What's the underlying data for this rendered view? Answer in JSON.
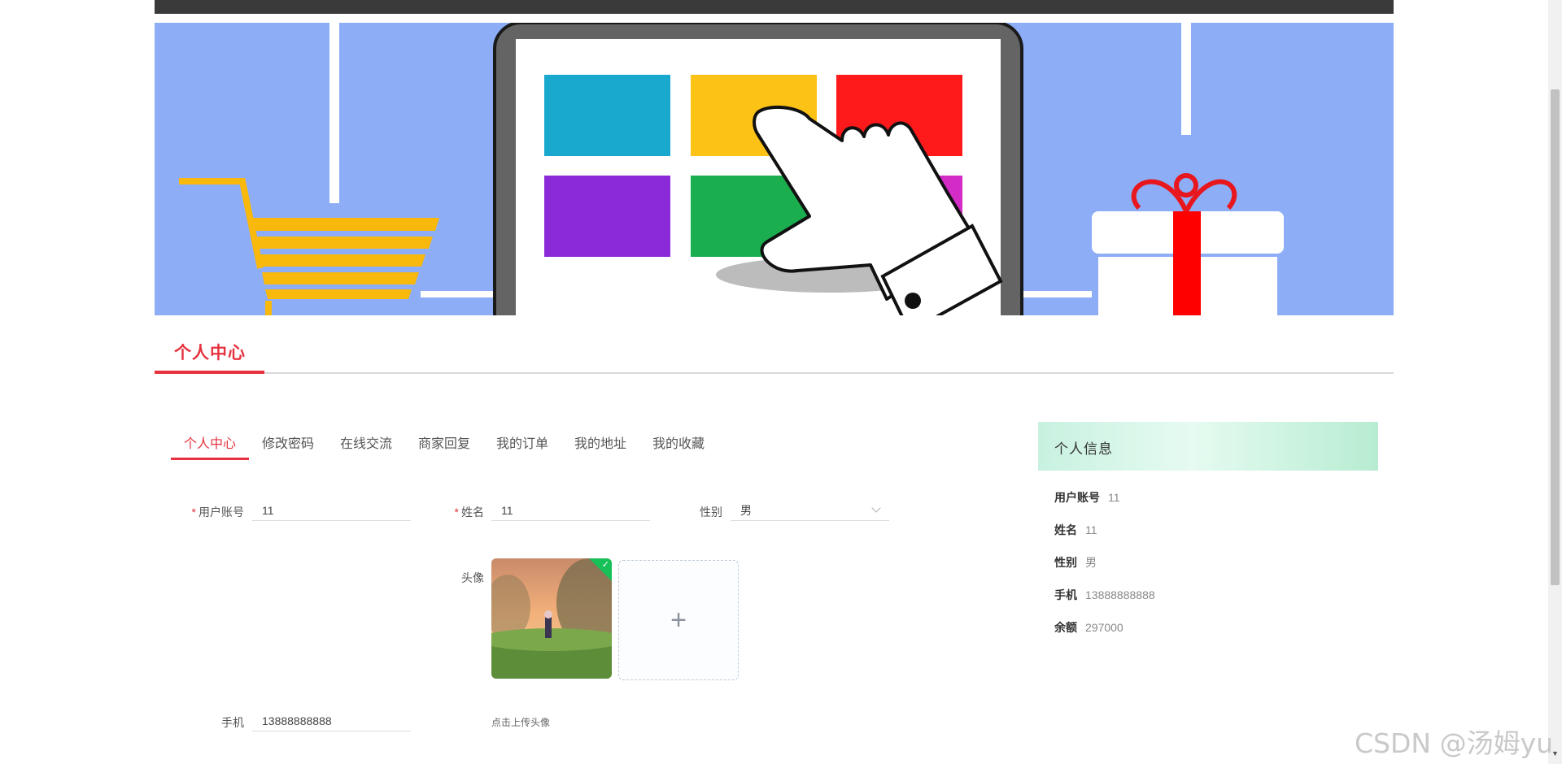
{
  "colors": {
    "accent": "#e6323e",
    "nav_bg": "#3a3a3a",
    "banner_bg": "#8dadf7",
    "success": "#18c058"
  },
  "page": {
    "section_title": "个人中心"
  },
  "tabs": [
    {
      "label": "个人中心",
      "active": true
    },
    {
      "label": "修改密码",
      "active": false
    },
    {
      "label": "在线交流",
      "active": false
    },
    {
      "label": "商家回复",
      "active": false
    },
    {
      "label": "我的订单",
      "active": false
    },
    {
      "label": "我的地址",
      "active": false
    },
    {
      "label": "我的收藏",
      "active": false
    }
  ],
  "form": {
    "account_label": "用户账号",
    "account_value": "11",
    "name_label": "姓名",
    "name_value": "11",
    "gender_label": "性别",
    "gender_value": "男",
    "avatar_label": "头像",
    "upload_hint": "点击上传头像",
    "upload_plus": "+",
    "upload_check": "✓",
    "phone_label": "手机",
    "phone_value": "13888888888",
    "required_mark": "*"
  },
  "info": {
    "title": "个人信息",
    "rows": [
      {
        "label": "用户账号",
        "value": "11"
      },
      {
        "label": "姓名",
        "value": "11"
      },
      {
        "label": "性别",
        "value": "男"
      },
      {
        "label": "手机",
        "value": "13888888888"
      },
      {
        "label": "余额",
        "value": "297000"
      }
    ]
  },
  "carousel": {
    "slide_count": 3,
    "active_index": 1
  },
  "watermark": "CSDN @汤姆yu"
}
